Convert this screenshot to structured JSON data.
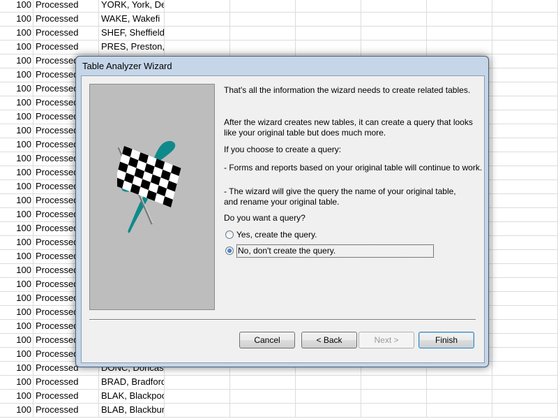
{
  "sheet": {
    "rows": [
      {
        "n": "100",
        "status": "Processed",
        "loc": "YORK, York, De"
      },
      {
        "n": "100",
        "status": "Processed",
        "loc": "WAKE, Wakefi"
      },
      {
        "n": "100",
        "status": "Processed",
        "loc": "SHEF, Sheffield"
      },
      {
        "n": "100",
        "status": "Processed",
        "loc": "PRES, Preston,"
      },
      {
        "n": "100",
        "status": "Processed",
        "loc": ""
      },
      {
        "n": "100",
        "status": "Processed",
        "loc": ""
      },
      {
        "n": "100",
        "status": "Processed",
        "loc": ""
      },
      {
        "n": "100",
        "status": "Processed",
        "loc": ""
      },
      {
        "n": "100",
        "status": "Processed",
        "loc": ""
      },
      {
        "n": "100",
        "status": "Processed",
        "loc": ""
      },
      {
        "n": "100",
        "status": "Processed",
        "loc": ""
      },
      {
        "n": "100",
        "status": "Processed",
        "loc": ""
      },
      {
        "n": "100",
        "status": "Processed",
        "loc": ""
      },
      {
        "n": "100",
        "status": "Processed",
        "loc": ""
      },
      {
        "n": "100",
        "status": "Processed",
        "loc": ""
      },
      {
        "n": "100",
        "status": "Processed",
        "loc": ""
      },
      {
        "n": "100",
        "status": "Processed",
        "loc": ""
      },
      {
        "n": "100",
        "status": "Processed",
        "loc": ""
      },
      {
        "n": "100",
        "status": "Processed",
        "loc": ""
      },
      {
        "n": "100",
        "status": "Processed",
        "loc": ""
      },
      {
        "n": "100",
        "status": "Processed",
        "loc": ""
      },
      {
        "n": "100",
        "status": "Processed",
        "loc": ""
      },
      {
        "n": "100",
        "status": "Processed",
        "loc": ""
      },
      {
        "n": "100",
        "status": "Processed",
        "loc": ""
      },
      {
        "n": "100",
        "status": "Processed",
        "loc": ""
      },
      {
        "n": "100",
        "status": "Processed",
        "loc": ""
      },
      {
        "n": "100",
        "status": "Processed",
        "loc": "DONC, Doncas"
      },
      {
        "n": "100",
        "status": "Processed",
        "loc": "BRAD, Bradford"
      },
      {
        "n": "100",
        "status": "Processed",
        "loc": "BLAK, Blackpoo"
      },
      {
        "n": "100",
        "status": "Processed",
        "loc": "BLAB, Blackbur"
      }
    ]
  },
  "dialog": {
    "title": "Table Analyzer Wizard",
    "line1": "That's all the information the wizard needs to create related tables.",
    "line2": "After the wizard creates new tables, it can create a query that looks like your original table but does much more.",
    "line3": "If you choose to create a query:",
    "line4": "- Forms and reports based on your original table will continue to work.",
    "line5": "- The wizard will give the query the name of your original table, and rename your original table.",
    "line6": "Do you want a query?",
    "option_yes": "Yes, create the query.",
    "option_no": "No, don't create the query.",
    "selected_option": "no",
    "buttons": {
      "cancel": "Cancel",
      "back": "< Back",
      "next": "Next >",
      "finish": "Finish"
    },
    "picture_icon": "checkered-flag-icon",
    "colors": {
      "accent_teal": "#0f8a8a",
      "picture_bg": "#bdbdbd"
    }
  }
}
